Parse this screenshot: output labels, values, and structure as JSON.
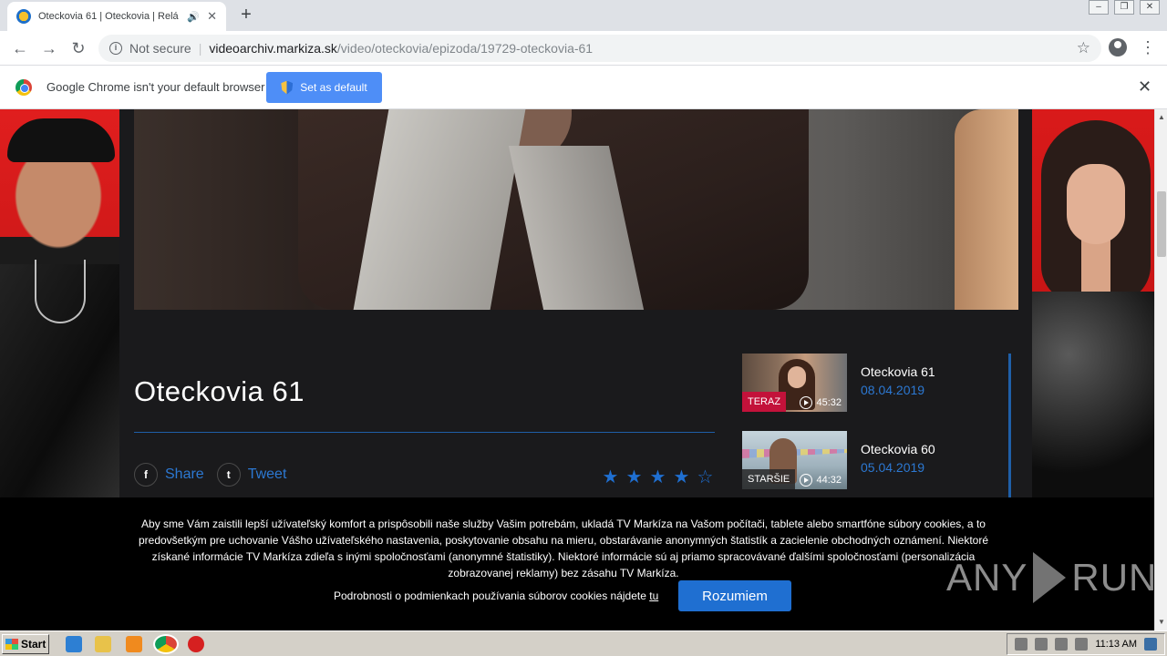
{
  "browser": {
    "tab_title": "Oteckovia 61 | Oteckovia | Relá",
    "address_security": "Not secure",
    "url_host": "videoarchiv.markiza.sk",
    "url_path": "/video/oteckovia/epizoda/19729-oteckovia-61"
  },
  "infobar": {
    "message": "Google Chrome isn't your default browser",
    "button_label": "Set as default"
  },
  "episode": {
    "title": "Oteckovia 61",
    "share_label": "Share",
    "tweet_label": "Tweet",
    "rating": 4,
    "rating_max": 5
  },
  "related": [
    {
      "name": "Oteckovia 61",
      "date": "08.04.2019",
      "badge": "TERAZ",
      "duration": "45:32"
    },
    {
      "name": "Oteckovia 60",
      "date": "05.04.2019",
      "badge": "STARŠIE",
      "duration": "44:32"
    }
  ],
  "cookie": {
    "text": "Aby sme Vám zaistili lepší užívateľský komfort a prispôsobili naše služby Vašim potrebám, ukladá TV Markíza na Vašom počítači, tablete alebo smartfóne súbory cookies, a to predovšetkým pre uchovanie Vášho užívateľského nastavenia, poskytovanie obsahu na mieru, obstarávanie anonymných štatistík a zacielenie obchodných oznámení. Niektoré získané informácie TV Markíza zdieľa s inými spoločnosťami (anonymné štatistiky). Niektoré informácie sú aj priamo spracovávané ďalšími spoločnosťami (personalizácia zobrazovanej reklamy) bez zásahu TV Markíza.",
    "more_text": "Podrobnosti o podmienkach používania súborov cookies nájdete",
    "more_link": "tu",
    "accept_label": "Rozumiem"
  },
  "watermark": {
    "left": "ANY",
    "right": "RUN"
  },
  "taskbar": {
    "start_label": "Start",
    "clock": "11:13 AM"
  }
}
